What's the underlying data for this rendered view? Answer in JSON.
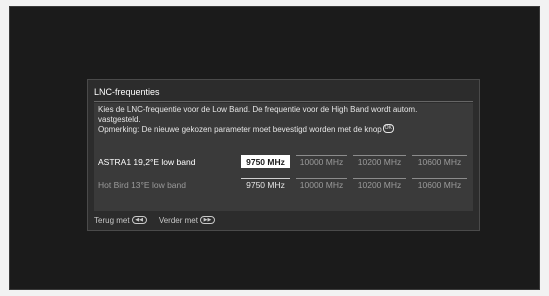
{
  "dialog": {
    "title": "LNC-frequenties",
    "info_line1": "Kies de LNC-frequentie voor de Low Band. De frequentie voor de High Band wordt autom.",
    "info_line2": "vastgesteld.",
    "info_line3": "Opmerking: De nieuwe gekozen parameter moet bevestigd worden met de knop",
    "ok_icon": "ok-button-icon",
    "rows": [
      {
        "label": "ASTRA1 19,2°E low band",
        "options": [
          "9750 MHz",
          "10000 MHz",
          "10200 MHz",
          "10600 MHz"
        ],
        "selected": "9750 MHz",
        "focused": true
      },
      {
        "label": "Hot Bird 13°E low band",
        "options": [
          "9750 MHz",
          "10000 MHz",
          "10200 MHz",
          "10600 MHz"
        ],
        "selected": "9750 MHz",
        "focused": false
      }
    ],
    "footer": {
      "back_label": "Terug met",
      "back_icon": "rewind-button-icon",
      "next_label": "Verder met",
      "next_icon": "forward-button-icon"
    }
  },
  "colors": {
    "screen_bg": "#1b1b1b",
    "dialog_bg": "#2c2c2c",
    "panel_bg": "#3a3a3a",
    "selected_bg": "#ffffff"
  }
}
